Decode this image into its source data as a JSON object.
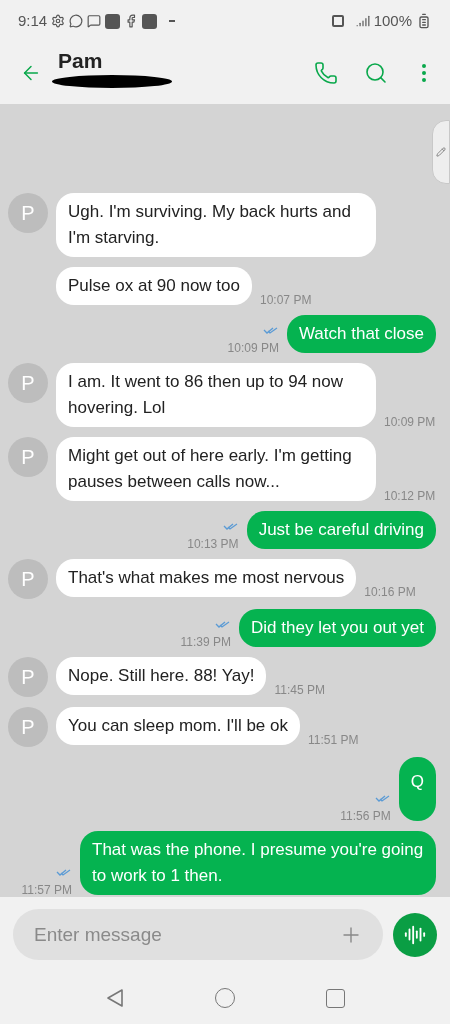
{
  "status_bar": {
    "time": "9:14",
    "battery": "100%"
  },
  "header": {
    "name": "Pam"
  },
  "messages": [
    {
      "kind": "incoming",
      "avatar": "P",
      "text": "Ugh. I'm surviving. My back hurts and I'm starving."
    },
    {
      "kind": "incoming",
      "text": "Pulse ox at 90 now too",
      "time": "10:07 PM"
    },
    {
      "kind": "outgoing",
      "text": "Watch that close",
      "time": "10:09 PM"
    },
    {
      "kind": "incoming",
      "avatar": "P",
      "text": "I am. It went to 86 then up to 94 now hovering. Lol",
      "time": "10:09 PM"
    },
    {
      "kind": "incoming",
      "avatar": "P",
      "text": "Might get out of here early. I'm getting pauses between calls now...",
      "time": "10:12 PM"
    },
    {
      "kind": "outgoing",
      "text": "Just be careful driving",
      "time": "10:13 PM"
    },
    {
      "kind": "incoming",
      "avatar": "P",
      "text": "That's what makes me most nervous",
      "time": "10:16 PM"
    },
    {
      "kind": "outgoing",
      "text": "Did they let you out yet",
      "time": "11:39 PM"
    },
    {
      "kind": "incoming",
      "avatar": "P",
      "text": "Nope. Still here. 88! Yay!",
      "time": "11:45 PM"
    },
    {
      "kind": "incoming",
      "avatar": "P",
      "text": "You can sleep mom. I'll be ok",
      "time": "11:51 PM"
    },
    {
      "kind": "outgoing",
      "text": "Q",
      "time": "11:56 PM",
      "tall": true
    },
    {
      "kind": "outgoing",
      "text": "That was the phone. I presume you're going to work to 1 then.",
      "time": "11:57 PM"
    }
  ],
  "composer": {
    "placeholder": "Enter message"
  }
}
